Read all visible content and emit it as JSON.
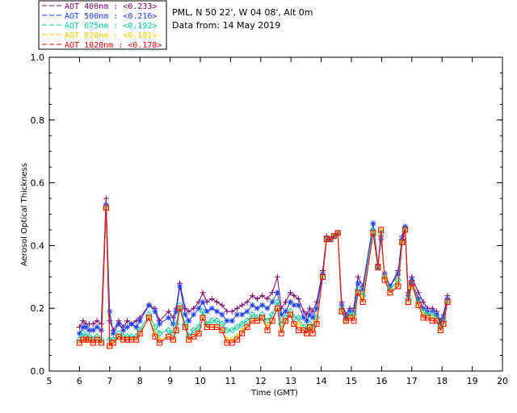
{
  "info": {
    "line1": "PML, N 50 22', W 04 08', Alt 0m",
    "line2": "Data from: 14 May 2019"
  },
  "chart_data": {
    "type": "line",
    "xlabel": "Time (GMT)",
    "ylabel": "Aerosol Optical Thickness",
    "xlim": [
      5,
      20
    ],
    "ylim": [
      0.0,
      1.0
    ],
    "xticks": [
      "5",
      "6",
      "7",
      "8",
      "9",
      "10",
      "11",
      "12",
      "13",
      "14",
      "15",
      "16",
      "17",
      "18",
      "19",
      "20"
    ],
    "yticks": [
      "0.0",
      "0.2",
      "0.4",
      "0.6",
      "0.8",
      "1.0"
    ],
    "grid": false,
    "legend_position": "top-left, above plot",
    "x": [
      6.0,
      6.12,
      6.22,
      6.32,
      6.45,
      6.58,
      6.72,
      6.88,
      7.0,
      7.12,
      7.3,
      7.45,
      7.58,
      7.72,
      7.88,
      8.0,
      8.3,
      8.5,
      8.65,
      8.95,
      9.1,
      9.2,
      9.32,
      9.5,
      9.62,
      9.78,
      9.95,
      10.08,
      10.22,
      10.38,
      10.55,
      10.72,
      10.88,
      11.05,
      11.22,
      11.38,
      11.55,
      11.72,
      11.88,
      12.05,
      12.22,
      12.38,
      12.55,
      12.68,
      12.82,
      12.98,
      13.1,
      13.25,
      13.42,
      13.52,
      13.62,
      13.72,
      13.85,
      14.05,
      14.18,
      14.3,
      14.42,
      14.55,
      14.68,
      14.82,
      14.95,
      15.08,
      15.22,
      15.38,
      15.72,
      15.88,
      15.98,
      16.1,
      16.28,
      16.55,
      16.68,
      16.78,
      16.88,
      17.0,
      17.22,
      17.38,
      17.52,
      17.68,
      17.82,
      17.95,
      18.05,
      18.18
    ],
    "series": [
      {
        "name": "AOT  400nm : <0.233>",
        "color": "#7a0070",
        "marker": "plus",
        "values": [
          0.14,
          0.16,
          0.15,
          0.15,
          0.15,
          0.16,
          0.15,
          0.55,
          0.16,
          0.13,
          0.16,
          0.14,
          0.16,
          0.15,
          0.16,
          0.17,
          0.21,
          0.2,
          0.16,
          0.19,
          0.17,
          0.2,
          0.28,
          0.2,
          0.19,
          0.2,
          0.22,
          0.25,
          0.22,
          0.23,
          0.22,
          0.21,
          0.19,
          0.19,
          0.2,
          0.21,
          0.22,
          0.24,
          0.23,
          0.24,
          0.23,
          0.25,
          0.3,
          0.2,
          0.22,
          0.25,
          0.24,
          0.23,
          0.19,
          0.18,
          0.2,
          0.19,
          0.22,
          0.32,
          0.43,
          0.42,
          0.43,
          0.44,
          0.22,
          0.18,
          0.2,
          0.2,
          0.3,
          0.27,
          0.47,
          0.34,
          0.43,
          0.31,
          0.27,
          0.32,
          0.43,
          0.46,
          0.25,
          0.3,
          0.25,
          0.22,
          0.2,
          0.2,
          0.19,
          0.16,
          0.18,
          0.24
        ]
      },
      {
        "name": "AOT  500nm : <0.216>",
        "color": "#1a3cff",
        "marker": "star",
        "values": [
          0.12,
          0.14,
          0.14,
          0.13,
          0.13,
          0.14,
          0.13,
          0.53,
          0.19,
          0.12,
          0.15,
          0.13,
          0.14,
          0.15,
          0.14,
          0.16,
          0.21,
          0.19,
          0.15,
          0.17,
          0.15,
          0.19,
          0.27,
          0.18,
          0.16,
          0.18,
          0.2,
          0.22,
          0.19,
          0.2,
          0.19,
          0.18,
          0.16,
          0.16,
          0.18,
          0.18,
          0.19,
          0.21,
          0.2,
          0.21,
          0.2,
          0.22,
          0.25,
          0.18,
          0.19,
          0.22,
          0.21,
          0.21,
          0.17,
          0.16,
          0.18,
          0.17,
          0.2,
          0.31,
          0.42,
          0.42,
          0.43,
          0.44,
          0.21,
          0.17,
          0.19,
          0.19,
          0.28,
          0.26,
          0.47,
          0.33,
          0.42,
          0.31,
          0.27,
          0.31,
          0.42,
          0.46,
          0.24,
          0.29,
          0.23,
          0.2,
          0.19,
          0.19,
          0.18,
          0.15,
          0.17,
          0.23
        ]
      },
      {
        "name": "AOT  675nm : <0.192>",
        "color": "#00cc99",
        "marker": "diamond",
        "values": [
          0.1,
          0.12,
          0.11,
          0.11,
          0.1,
          0.11,
          0.1,
          0.52,
          0.1,
          0.1,
          0.12,
          0.11,
          0.11,
          0.11,
          0.11,
          0.13,
          0.18,
          0.14,
          0.12,
          0.13,
          0.12,
          0.15,
          0.21,
          0.15,
          0.11,
          0.13,
          0.14,
          0.19,
          0.15,
          0.16,
          0.16,
          0.15,
          0.13,
          0.13,
          0.14,
          0.15,
          0.16,
          0.18,
          0.17,
          0.18,
          0.16,
          0.18,
          0.22,
          0.15,
          0.17,
          0.19,
          0.17,
          0.17,
          0.14,
          0.13,
          0.15,
          0.14,
          0.17,
          0.3,
          0.42,
          0.42,
          0.43,
          0.44,
          0.2,
          0.16,
          0.18,
          0.18,
          0.26,
          0.24,
          0.45,
          0.33,
          0.44,
          0.3,
          0.26,
          0.29,
          0.41,
          0.45,
          0.23,
          0.28,
          0.22,
          0.19,
          0.18,
          0.18,
          0.17,
          0.14,
          0.16,
          0.22
        ]
      },
      {
        "name": "AOT  870nm : <0.181>",
        "color": "#ffcc00",
        "marker": "triangle",
        "values": [
          0.09,
          0.1,
          0.1,
          0.1,
          0.09,
          0.1,
          0.09,
          0.52,
          0.08,
          0.09,
          0.11,
          0.1,
          0.1,
          0.1,
          0.1,
          0.12,
          0.17,
          0.12,
          0.1,
          0.11,
          0.1,
          0.13,
          0.2,
          0.14,
          0.1,
          0.11,
          0.12,
          0.17,
          0.14,
          0.14,
          0.14,
          0.13,
          0.1,
          0.1,
          0.11,
          0.13,
          0.14,
          0.16,
          0.16,
          0.17,
          0.14,
          0.16,
          0.2,
          0.13,
          0.16,
          0.18,
          0.15,
          0.15,
          0.13,
          0.12,
          0.14,
          0.13,
          0.16,
          0.3,
          0.42,
          0.42,
          0.43,
          0.44,
          0.19,
          0.16,
          0.17,
          0.17,
          0.25,
          0.23,
          0.44,
          0.33,
          0.45,
          0.3,
          0.25,
          0.28,
          0.41,
          0.45,
          0.22,
          0.27,
          0.21,
          0.18,
          0.17,
          0.17,
          0.16,
          0.13,
          0.15,
          0.22
        ]
      },
      {
        "name": "AOT 1020nm : <0.178>",
        "color": "#ff0000",
        "marker": "square",
        "values": [
          0.09,
          0.1,
          0.1,
          0.1,
          0.09,
          0.1,
          0.09,
          0.52,
          0.08,
          0.09,
          0.11,
          0.1,
          0.1,
          0.1,
          0.1,
          0.12,
          0.17,
          0.11,
          0.09,
          0.11,
          0.1,
          0.13,
          0.2,
          0.14,
          0.1,
          0.11,
          0.12,
          0.17,
          0.14,
          0.14,
          0.14,
          0.13,
          0.09,
          0.09,
          0.1,
          0.12,
          0.14,
          0.16,
          0.16,
          0.17,
          0.13,
          0.16,
          0.2,
          0.12,
          0.16,
          0.18,
          0.15,
          0.13,
          0.13,
          0.12,
          0.14,
          0.12,
          0.15,
          0.3,
          0.42,
          0.42,
          0.43,
          0.44,
          0.19,
          0.16,
          0.17,
          0.16,
          0.25,
          0.22,
          0.44,
          0.33,
          0.45,
          0.29,
          0.25,
          0.27,
          0.41,
          0.45,
          0.22,
          0.28,
          0.21,
          0.17,
          0.17,
          0.16,
          0.16,
          0.13,
          0.15,
          0.22
        ]
      }
    ]
  }
}
